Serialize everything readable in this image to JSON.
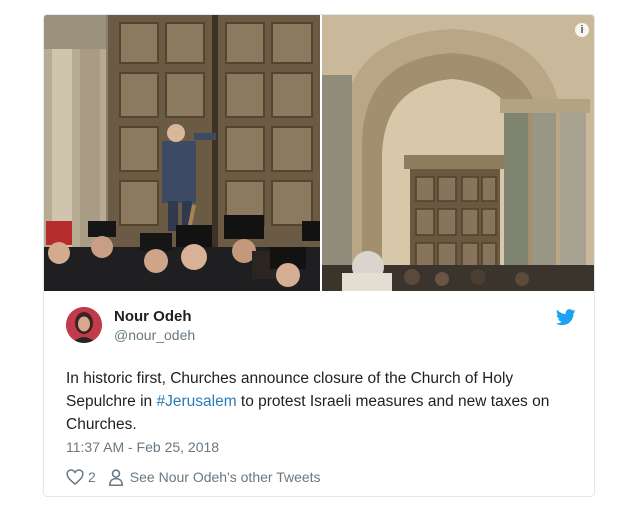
{
  "tweet": {
    "author_name": "Nour Odeh",
    "author_handle": "@nour_odeh",
    "text_before": "In historic first, Churches announce closure of the Church of Holy Sepulchre in ",
    "hashtag": "#Jerusalem",
    "text_after": " to protest Israeli measures and new taxes on Churches.",
    "timestamp": "11:37 AM - Feb 25, 2018",
    "like_count": "2",
    "see_more_label": "See Nour Odeh's other Tweets"
  },
  "icons": {
    "info": "info-icon",
    "brand": "twitter-bird-icon",
    "like": "heart-icon",
    "profile": "person-icon"
  },
  "colors": {
    "brand_blue": "#1da1f2",
    "link_blue": "#2b7bb9",
    "text": "#1c2022",
    "secondary_text": "#697882",
    "border": "#e1e8ed"
  }
}
